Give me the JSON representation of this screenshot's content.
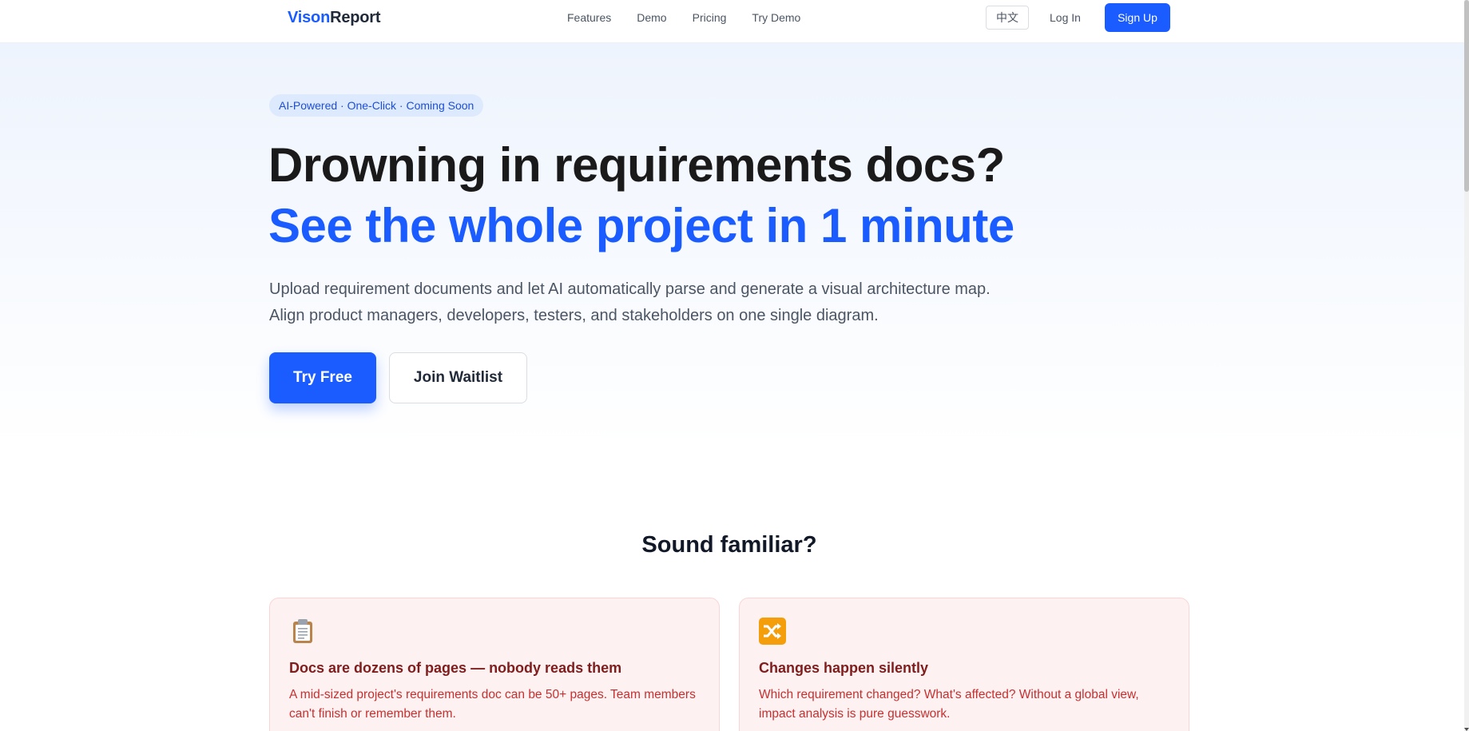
{
  "nav": {
    "logo_part_1": "Vison",
    "logo_part_2": "Report",
    "links": [
      "Features",
      "Demo",
      "Pricing",
      "Try Demo"
    ],
    "lang_label": "中文",
    "login_label": "Log In",
    "signup_label": "Sign Up"
  },
  "hero": {
    "badge": "AI-Powered · One-Click · Coming Soon",
    "title_line_1": "Drowning in requirements docs?",
    "title_line_2": "See the whole project in 1 minute",
    "desc_line_1": "Upload requirement documents and let AI automatically parse and generate a visual architecture map.",
    "desc_line_2": "Align product managers, developers, testers, and stakeholders on one single diagram.",
    "primary_cta": "Try Free",
    "secondary_cta": "Join Waitlist"
  },
  "problems": {
    "title": "Sound familiar?",
    "cards": [
      {
        "icon": "clipboard-icon",
        "title": "Docs are dozens of pages — nobody reads them",
        "desc": "A mid-sized project's requirements doc can be 50+ pages. Team members can't finish or remember them."
      },
      {
        "icon": "shuffle-icon",
        "title": "Changes happen silently",
        "desc": "Which requirement changed? What's affected? Without a global view, impact analysis is pure guesswork."
      }
    ]
  },
  "colors": {
    "brand": "#1a5cff",
    "card_bg": "#fef1f1",
    "card_title": "#7f1d1d",
    "card_text": "#c53030"
  }
}
